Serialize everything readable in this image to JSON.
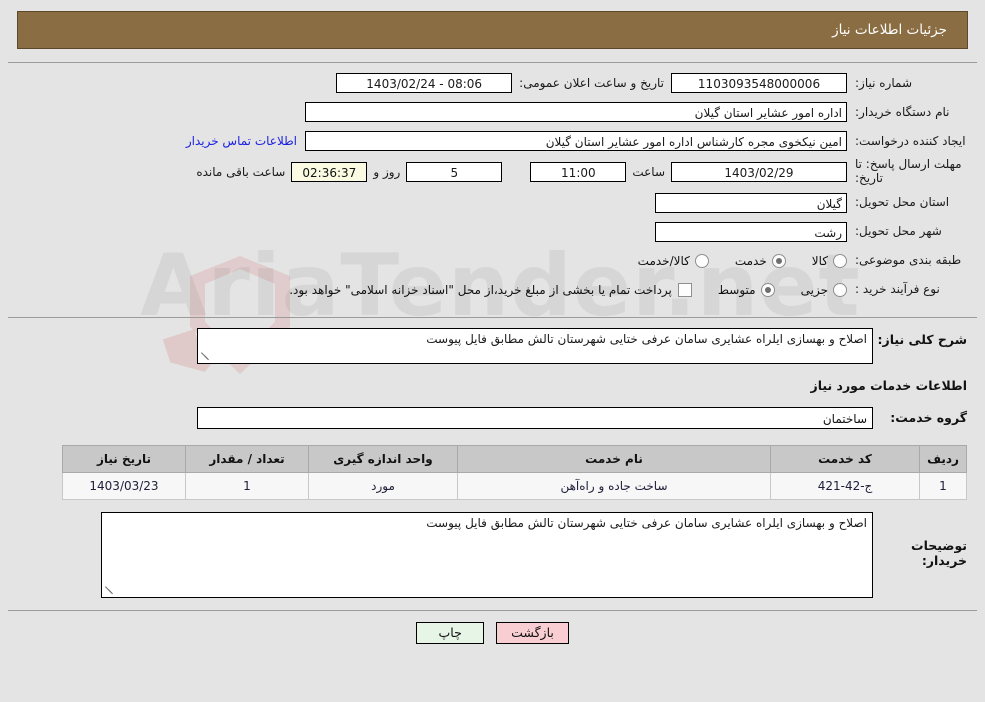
{
  "header": {
    "title": "جزئیات اطلاعات نیاز"
  },
  "watermark": {
    "text": "AriaTender.net"
  },
  "form": {
    "need_number": {
      "label": "شماره نیاز:",
      "value": "1103093548000006"
    },
    "public_announce": {
      "label": "تاریخ و ساعت اعلان عمومی:",
      "value": "08:06 - 1403/02/24"
    },
    "buyer_org": {
      "label": "نام دستگاه خریدار:",
      "value": "اداره امور عشایر استان گیلان"
    },
    "requester": {
      "label": "ایجاد کننده درخواست:",
      "value": "امین نیکخوی مجره کارشناس اداره امور عشایر استان گیلان"
    },
    "contact_link": "اطلاعات تماس خریدار",
    "deadline": {
      "label": "مهلت ارسال پاسخ: تا تاریخ:",
      "date": "1403/02/29",
      "time_label": "ساعت",
      "time": "11:00",
      "days": "5",
      "days_label": "روز و",
      "countdown": "02:36:37",
      "remaining_label": "ساعت باقی مانده"
    },
    "delivery_province": {
      "label": "استان محل تحویل:",
      "value": "گیلان"
    },
    "delivery_city": {
      "label": "شهر محل تحویل:",
      "value": "رشت"
    },
    "category": {
      "label": "طبقه بندی موضوعی:",
      "options": [
        {
          "label": "کالا",
          "selected": false
        },
        {
          "label": "خدمت",
          "selected": true
        },
        {
          "label": "کالا/خدمت",
          "selected": false
        }
      ]
    },
    "purchase_type": {
      "label": "نوع فرآیند خرید :",
      "options": [
        {
          "label": "جزیی",
          "selected": false
        },
        {
          "label": "متوسط",
          "selected": true
        }
      ],
      "treasury_note": "پرداخت تمام یا بخشی از مبلغ خرید،از محل \"اسناد خزانه اسلامی\" خواهد بود.",
      "treasury_checked": false
    }
  },
  "details": {
    "general_desc_label": "شرح کلی نیاز:",
    "general_desc_value": "اصلاح و بهسازی ایلراه عشایری سامان عرفی ختایی شهرستان تالش مطابق فایل پیوست",
    "services_heading": "اطلاعات خدمات مورد نیاز",
    "service_group_label": "گروه خدمت:",
    "service_group_value": "ساختمان",
    "buyer_comments_label": "توضیحات خریدار:",
    "buyer_comments_value": "اصلاح و بهسازی ایلراه عشایری سامان عرفی ختایی شهرستان تالش مطابق فایل پیوست"
  },
  "table": {
    "headers": {
      "row": "ردیف",
      "code": "کد خدمت",
      "name": "نام خدمت",
      "unit": "واحد اندازه گیری",
      "qty": "تعداد / مقدار",
      "date": "تاریخ نیاز"
    },
    "rows": [
      {
        "row": "1",
        "code": "ج-42-421",
        "name": "ساخت جاده و راه‌آهن",
        "unit": "مورد",
        "qty": "1",
        "date": "1403/03/23"
      }
    ]
  },
  "buttons": {
    "print": "چاپ",
    "back": "بازگشت"
  }
}
